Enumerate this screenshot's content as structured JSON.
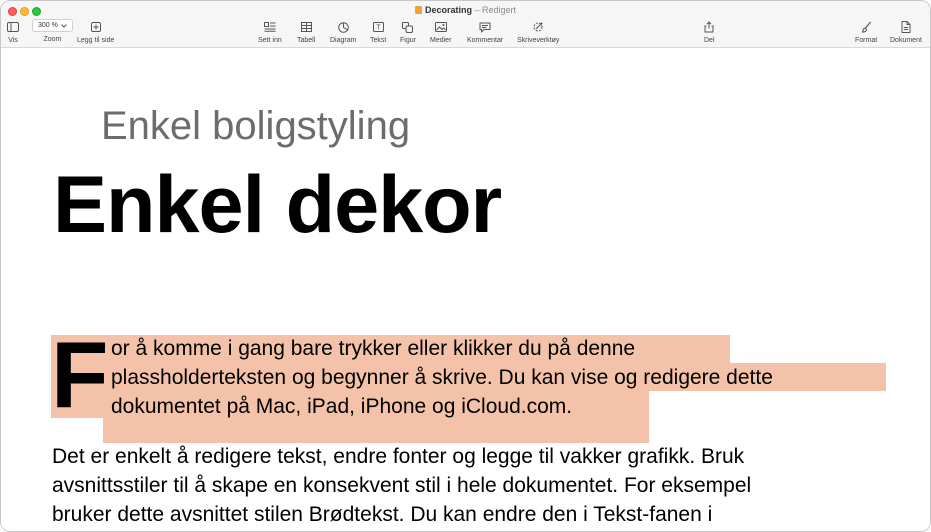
{
  "window": {
    "doc_name": "Decorating",
    "separator": "–",
    "doc_state": "Redigert"
  },
  "toolbar": {
    "view_label": "Vis",
    "zoom_value": "300 %",
    "zoom_label": "Zoom",
    "add_page_label": "Legg til side",
    "insert_label": "Sett inn",
    "table_label": "Tabell",
    "chart_label": "Diagram",
    "text_label": "Tekst",
    "shape_label": "Figur",
    "media_label": "Medier",
    "comment_label": "Kommentar",
    "writing_tools_label": "Skriveverktøy",
    "share_label": "Del",
    "format_label": "Format",
    "document_label": "Dokument"
  },
  "document": {
    "subtitle": "Enkel boligstyling",
    "title": "Enkel dekor",
    "dropcap": "F",
    "para1": [
      "or å komme i gang bare trykker eller klikker du på denne",
      "plassholderteksten og begynner å skrive. Du kan vise og redigere dette",
      "dokumentet på Mac, iPad, iPhone og iCloud.com."
    ],
    "para2": [
      "Det er enkelt å redigere tekst, endre fonter og legge til vakker grafikk. Bruk",
      "avsnittsstiler til å skape en konsekvent stil i hele dokumentet. For eksempel",
      "bruker dette avsnittet stilen Brødtekst. Du kan endre den i Tekst-fanen i"
    ]
  },
  "colors": {
    "selection_highlight": "#f3c2a8",
    "subtitle_gray": "#6c6c6c"
  }
}
